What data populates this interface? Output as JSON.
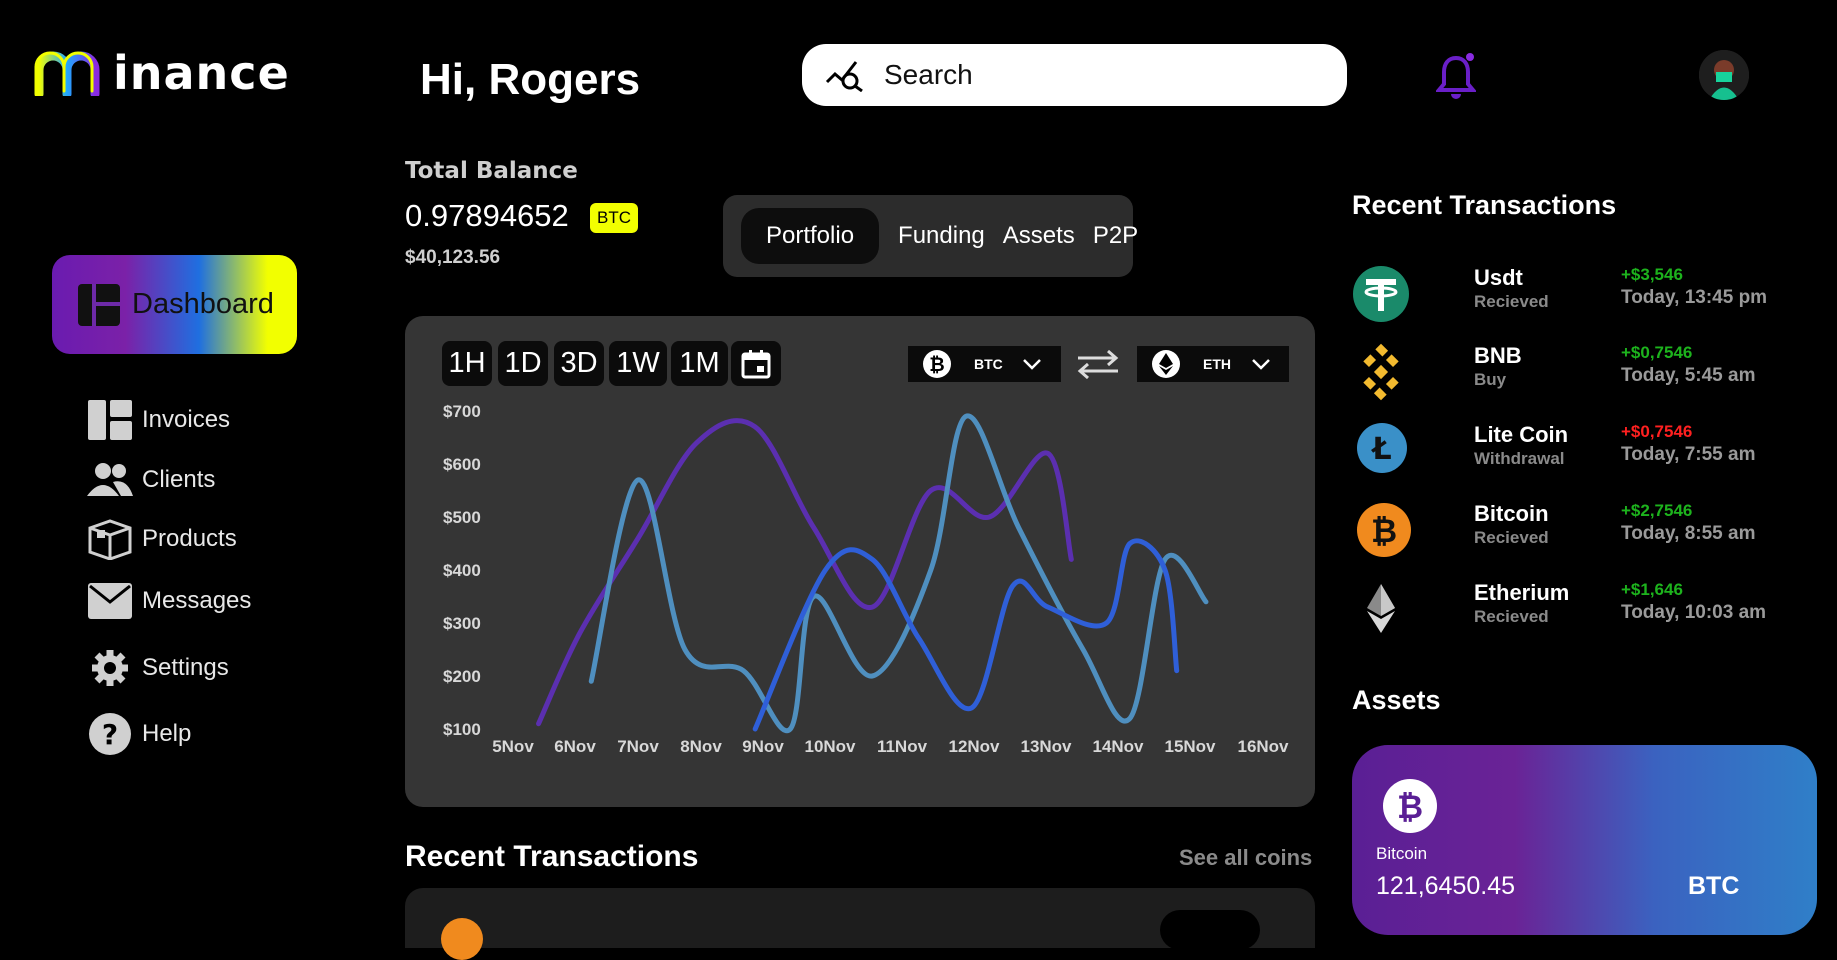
{
  "brand": {
    "logo_text": "inance",
    "logo_letter": "M"
  },
  "header": {
    "greeting": "Hi, Rogers",
    "search_placeholder": "Search"
  },
  "sidebar": {
    "active": "Dashboard",
    "items": [
      {
        "label": "Invoices",
        "icon": "invoices-icon"
      },
      {
        "label": "Clients",
        "icon": "clients-icon"
      },
      {
        "label": "Products",
        "icon": "products-icon"
      },
      {
        "label": "Messages",
        "icon": "messages-icon"
      },
      {
        "label": "Settings",
        "icon": "settings-icon"
      },
      {
        "label": "Help",
        "icon": "help-icon"
      }
    ]
  },
  "balance": {
    "label": "Total Balance",
    "value": "0.97894652",
    "unit": "BTC",
    "usd": "$40,123.56"
  },
  "tabs": [
    "Portfolio",
    "Funding",
    "Assets",
    "P2P"
  ],
  "chart": {
    "ranges": [
      "1H",
      "1D",
      "3D",
      "1W",
      "1M"
    ],
    "from_symbol": "BTC",
    "to_symbol": "ETH"
  },
  "chart_data": {
    "type": "line",
    "x": [
      "5Nov",
      "6Nov",
      "7Nov",
      "8Nov",
      "9Nov",
      "10Nov",
      "11Nov",
      "12Nov",
      "13Nov",
      "14Nov",
      "15Nov",
      "16Nov"
    ],
    "yticks": [
      "$700",
      "$600",
      "$500",
      "$400",
      "$300",
      "$200",
      "$100"
    ],
    "ylim": [
      100,
      700
    ],
    "grid": false,
    "series": [
      {
        "color": "#5b2fb0",
        "points": [
          [
            0.3,
            110
          ],
          [
            1,
            280
          ],
          [
            2,
            460
          ],
          [
            3,
            640
          ],
          [
            4,
            670
          ],
          [
            5,
            480
          ],
          [
            6,
            330
          ],
          [
            7,
            550
          ],
          [
            8,
            500
          ],
          [
            9,
            620
          ],
          [
            9.4,
            420
          ]
        ]
      },
      {
        "color": "#4f8fbf",
        "points": [
          [
            1.2,
            190
          ],
          [
            2,
            570
          ],
          [
            2.8,
            250
          ],
          [
            3.8,
            210
          ],
          [
            4.6,
            100
          ],
          [
            5,
            350
          ],
          [
            6,
            200
          ],
          [
            7,
            400
          ],
          [
            7.6,
            690
          ],
          [
            8.5,
            480
          ],
          [
            9.6,
            250
          ],
          [
            10.4,
            120
          ],
          [
            11,
            420
          ],
          [
            11.7,
            340
          ]
        ]
      },
      {
        "color": "#2f5fd8",
        "points": [
          [
            4,
            100
          ],
          [
            5.2,
            400
          ],
          [
            6,
            420
          ],
          [
            6.8,
            270
          ],
          [
            7.7,
            140
          ],
          [
            8.4,
            370
          ],
          [
            9,
            330
          ],
          [
            10,
            300
          ],
          [
            10.4,
            450
          ],
          [
            11,
            400
          ],
          [
            11.2,
            210
          ]
        ]
      }
    ]
  },
  "recent_transactions": {
    "title": "Recent Transactions",
    "items": [
      {
        "name": "Usdt",
        "type": "Recieved",
        "amount": "+$3,546",
        "time": "Today, 13:45 pm",
        "amount_color": "#1db31d",
        "coin": "usdt-icon"
      },
      {
        "name": "BNB",
        "type": "Buy",
        "amount": "+$0,7546",
        "time": "Today, 5:45 am",
        "amount_color": "#1db31d",
        "coin": "bnb-icon"
      },
      {
        "name": "Lite Coin",
        "type": "Withdrawal",
        "amount": "+$0,7546",
        "time": "Today, 7:55 am",
        "amount_color": "#ff2020",
        "coin": "litecoin-icon"
      },
      {
        "name": "Bitcoin",
        "type": "Recieved",
        "amount": "+$2,7546",
        "time": "Today, 8:55 am",
        "amount_color": "#1db31d",
        "coin": "bitcoin-icon"
      },
      {
        "name": "Etherium",
        "type": "Recieved",
        "amount": "+$1,646",
        "time": "Today, 10:03 am",
        "amount_color": "#1db31d",
        "coin": "ethereum-icon"
      }
    ]
  },
  "assets": {
    "title": "Assets",
    "card": {
      "name": "Bitcoin",
      "value": "121,6450.45",
      "symbol": "BTC"
    }
  },
  "bottom": {
    "title": "Recent Transactions",
    "see_all": "See all coins"
  }
}
